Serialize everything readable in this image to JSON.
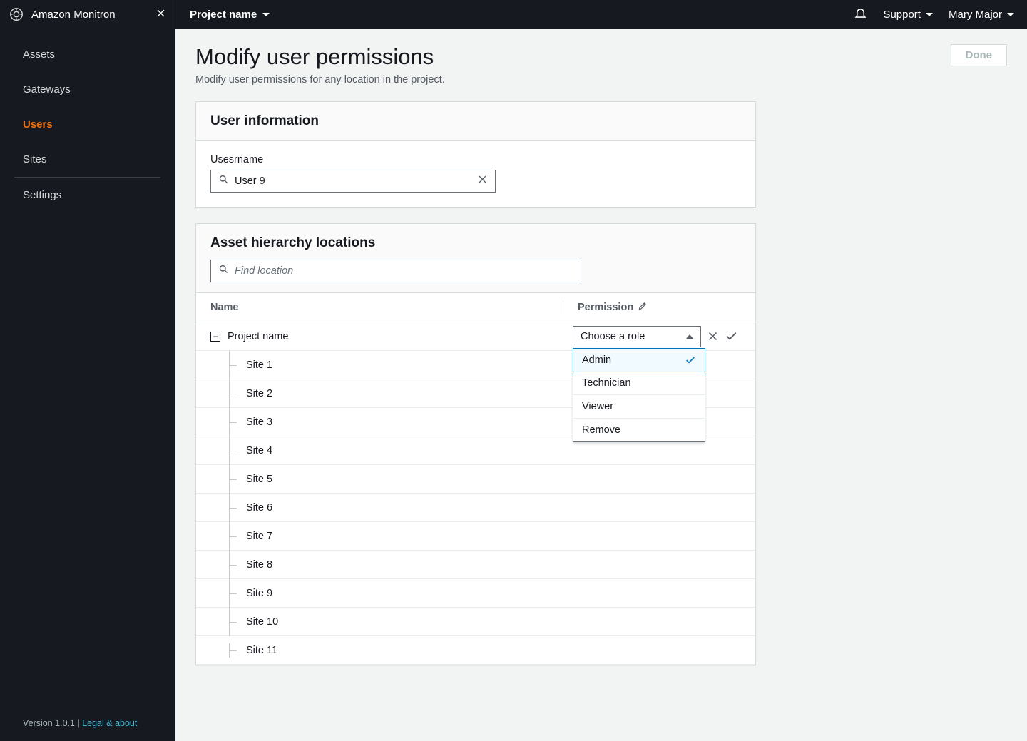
{
  "topbar": {
    "brand": "Amazon Monitron",
    "project_dropdown": "Project name",
    "support": "Support",
    "user": "Mary Major"
  },
  "sidebar": {
    "items": [
      {
        "label": "Assets"
      },
      {
        "label": "Gateways"
      },
      {
        "label": "Users"
      },
      {
        "label": "Sites"
      },
      {
        "label": "Settings"
      }
    ],
    "version_prefix": "Version ",
    "version": "1.0.1",
    "legal_link": "Legal & about"
  },
  "page": {
    "title": "Modify user permissions",
    "subtitle": "Modify user permissions for any location in the project.",
    "done_label": "Done"
  },
  "user_info": {
    "title": "User information",
    "username_label": "Usesrname",
    "username_value": "User 9"
  },
  "locations": {
    "title": "Asset hierarchy locations",
    "search_placeholder": "Find location",
    "columns": {
      "name": "Name",
      "permission": "Permission"
    },
    "root": "Project name",
    "role_placeholder": "Choose a role",
    "role_options": [
      "Admin",
      "Technician",
      "Viewer",
      "Remove"
    ],
    "sites": [
      "Site 1",
      "Site 2",
      "Site 3",
      "Site 4",
      "Site 5",
      "Site 6",
      "Site 7",
      "Site 8",
      "Site 9",
      "Site 10",
      "Site 11"
    ]
  }
}
